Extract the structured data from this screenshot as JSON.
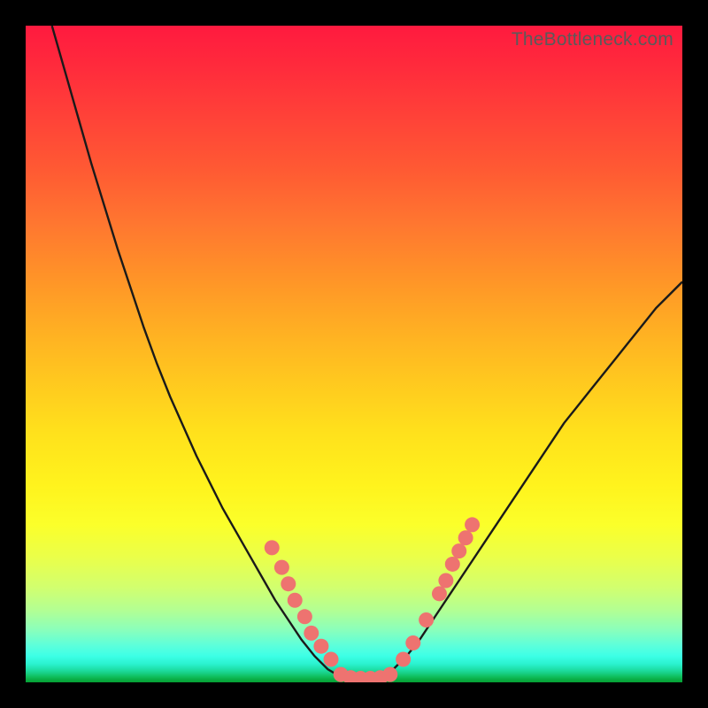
{
  "watermark": "TheBottleneck.com",
  "colors": {
    "frame": "#000000",
    "curve_stroke": "#1a1a1a",
    "marker_fill": "#ee7370",
    "marker_stroke": "#d85a57"
  },
  "chart_data": {
    "type": "line",
    "title": "",
    "xlabel": "",
    "ylabel": "",
    "xlim": [
      0,
      100
    ],
    "ylim": [
      0,
      100
    ],
    "curve": [
      {
        "x": 4.0,
        "y": 100.0
      },
      {
        "x": 6.0,
        "y": 93.0
      },
      {
        "x": 8.0,
        "y": 86.0
      },
      {
        "x": 10.0,
        "y": 79.0
      },
      {
        "x": 12.0,
        "y": 72.5
      },
      {
        "x": 14.0,
        "y": 66.0
      },
      {
        "x": 16.0,
        "y": 60.0
      },
      {
        "x": 18.0,
        "y": 54.0
      },
      {
        "x": 20.0,
        "y": 48.5
      },
      {
        "x": 22.0,
        "y": 43.5
      },
      {
        "x": 24.0,
        "y": 39.0
      },
      {
        "x": 26.0,
        "y": 34.5
      },
      {
        "x": 28.0,
        "y": 30.5
      },
      {
        "x": 30.0,
        "y": 26.5
      },
      {
        "x": 32.0,
        "y": 23.0
      },
      {
        "x": 34.0,
        "y": 19.5
      },
      {
        "x": 36.0,
        "y": 16.0
      },
      {
        "x": 38.0,
        "y": 12.5
      },
      {
        "x": 40.0,
        "y": 9.5
      },
      {
        "x": 42.0,
        "y": 6.5
      },
      {
        "x": 44.0,
        "y": 4.0
      },
      {
        "x": 46.0,
        "y": 2.0
      },
      {
        "x": 48.0,
        "y": 0.8
      },
      {
        "x": 50.0,
        "y": 0.5
      },
      {
        "x": 52.0,
        "y": 0.5
      },
      {
        "x": 54.0,
        "y": 0.8
      },
      {
        "x": 56.0,
        "y": 2.0
      },
      {
        "x": 58.0,
        "y": 4.0
      },
      {
        "x": 60.0,
        "y": 6.5
      },
      {
        "x": 62.0,
        "y": 9.5
      },
      {
        "x": 64.0,
        "y": 12.5
      },
      {
        "x": 66.0,
        "y": 15.5
      },
      {
        "x": 68.0,
        "y": 18.5
      },
      {
        "x": 70.0,
        "y": 21.5
      },
      {
        "x": 72.0,
        "y": 24.5
      },
      {
        "x": 74.0,
        "y": 27.5
      },
      {
        "x": 76.0,
        "y": 30.5
      },
      {
        "x": 78.0,
        "y": 33.5
      },
      {
        "x": 80.0,
        "y": 36.5
      },
      {
        "x": 82.0,
        "y": 39.5
      },
      {
        "x": 84.0,
        "y": 42.0
      },
      {
        "x": 86.0,
        "y": 44.5
      },
      {
        "x": 88.0,
        "y": 47.0
      },
      {
        "x": 90.0,
        "y": 49.5
      },
      {
        "x": 92.0,
        "y": 52.0
      },
      {
        "x": 94.0,
        "y": 54.5
      },
      {
        "x": 96.0,
        "y": 57.0
      },
      {
        "x": 98.0,
        "y": 59.0
      },
      {
        "x": 100.0,
        "y": 61.0
      }
    ],
    "markers": [
      {
        "x": 37.5,
        "y": 20.5
      },
      {
        "x": 39.0,
        "y": 17.5
      },
      {
        "x": 40.0,
        "y": 15.0
      },
      {
        "x": 41.0,
        "y": 12.5
      },
      {
        "x": 42.5,
        "y": 10.0
      },
      {
        "x": 43.5,
        "y": 7.5
      },
      {
        "x": 45.0,
        "y": 5.5
      },
      {
        "x": 46.5,
        "y": 3.5
      },
      {
        "x": 48.0,
        "y": 1.2
      },
      {
        "x": 49.5,
        "y": 0.7
      },
      {
        "x": 51.0,
        "y": 0.6
      },
      {
        "x": 52.5,
        "y": 0.6
      },
      {
        "x": 54.0,
        "y": 0.7
      },
      {
        "x": 55.5,
        "y": 1.2
      },
      {
        "x": 57.5,
        "y": 3.5
      },
      {
        "x": 59.0,
        "y": 6.0
      },
      {
        "x": 61.0,
        "y": 9.5
      },
      {
        "x": 63.0,
        "y": 13.5
      },
      {
        "x": 64.0,
        "y": 15.5
      },
      {
        "x": 65.0,
        "y": 18.0
      },
      {
        "x": 66.0,
        "y": 20.0
      },
      {
        "x": 67.0,
        "y": 22.0
      },
      {
        "x": 68.0,
        "y": 24.0
      }
    ]
  }
}
